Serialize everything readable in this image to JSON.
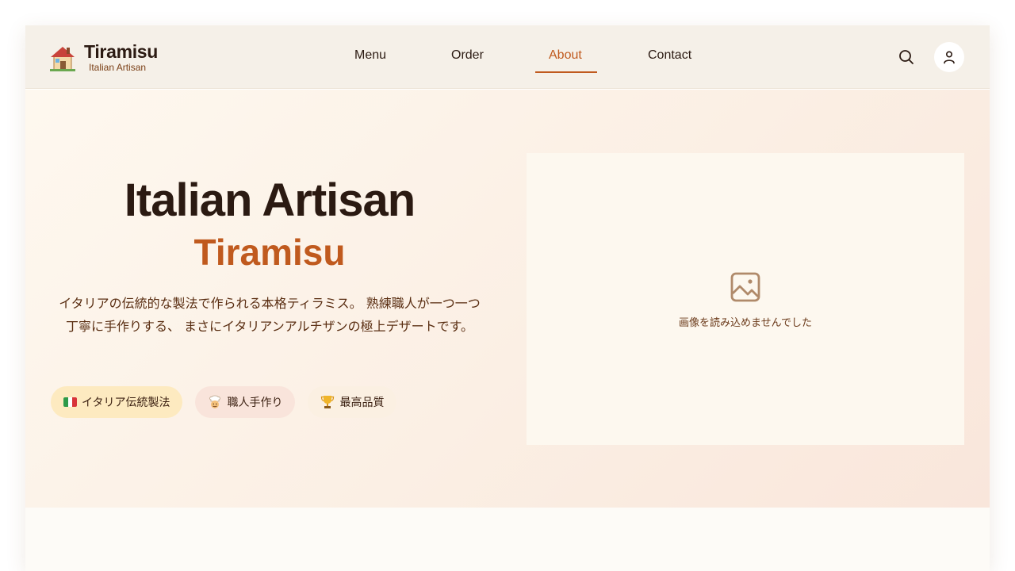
{
  "header": {
    "logo_title": "Tiramisu",
    "logo_subtitle": "Italian Artisan",
    "logo_icon": "house-icon",
    "nav": [
      {
        "label": "Menu",
        "active": false
      },
      {
        "label": "Order",
        "active": false
      },
      {
        "label": "About",
        "active": true
      },
      {
        "label": "Contact",
        "active": false
      }
    ],
    "search_icon": "search-icon",
    "user_icon": "user-icon"
  },
  "hero": {
    "title": "Italian Artisan",
    "subtitle": "Tiramisu",
    "description": "イタリアの伝統的な製法で作られる本格ティラミス。 熟練職人が一つ一つ丁寧に手作りする、 まさにイタリアンアルチザンの極上デザートです。",
    "badges": [
      {
        "icon": "italy-flag-icon",
        "label": "イタリア伝統製法"
      },
      {
        "icon": "chef-icon",
        "label": "職人手作り"
      },
      {
        "icon": "trophy-icon",
        "label": "最高品質"
      }
    ],
    "image_error": "画像を読み込めませんでした"
  },
  "colors": {
    "accent": "#c05a1e",
    "text_dark": "#2b1a12",
    "header_bg": "#f5f0e8",
    "hero_bg": "#fcf1e6"
  }
}
